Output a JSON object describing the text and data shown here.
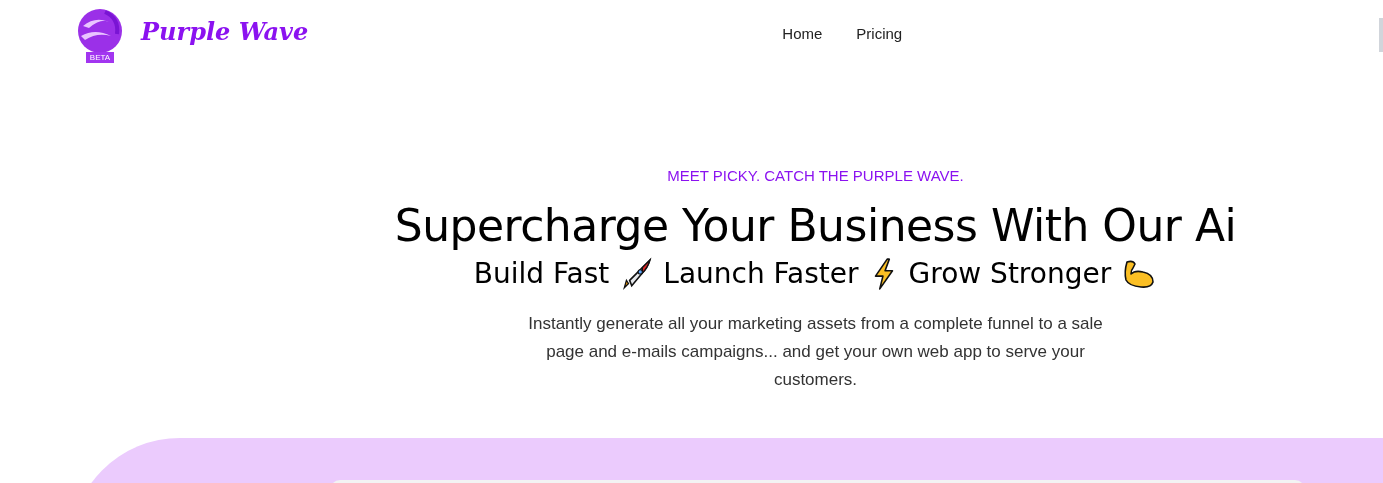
{
  "brand": {
    "name": "Purple Wave",
    "badge": "BETA"
  },
  "nav": [
    {
      "label": "Home"
    },
    {
      "label": "Pricing"
    }
  ],
  "hero": {
    "eyebrow": "MEET PICKY. CATCH THE PURPLE WAVE.",
    "title": "Supercharge Your Business With Our Ai",
    "tagline": [
      {
        "text": "Build Fast",
        "kind": "rocket"
      },
      {
        "text": "Launch Faster",
        "kind": "bolt"
      },
      {
        "text": "Grow Stronger",
        "kind": "arm"
      }
    ],
    "description": "Instantly generate all your marketing assets from a complete funnel to a sale page and e-mails campaigns... and get your own web app to serve your customers."
  }
}
